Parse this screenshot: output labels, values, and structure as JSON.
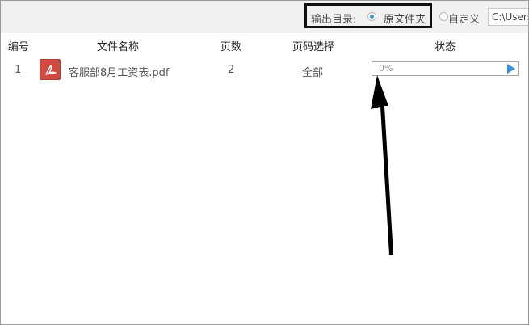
{
  "output_bar": {
    "label": "输出目录:",
    "option_original": "原文件夹",
    "option_custom": "自定义",
    "selected": "original",
    "path_value": "C:\\Users"
  },
  "table": {
    "headers": {
      "no": "编号",
      "name": "文件名称",
      "pages": "页数",
      "page_select": "页码选择",
      "status": "状态"
    },
    "rows": [
      {
        "no": "1",
        "icon": "pdf-file-icon",
        "name": "客服部8月工资表.pdf",
        "pages": "2",
        "page_select": "全部",
        "progress_text": "0%",
        "progress": 0
      }
    ]
  },
  "colors": {
    "accent": "#3d8fd6",
    "pdf_icon": "#d04a3f",
    "highlight_box": "#111111"
  }
}
